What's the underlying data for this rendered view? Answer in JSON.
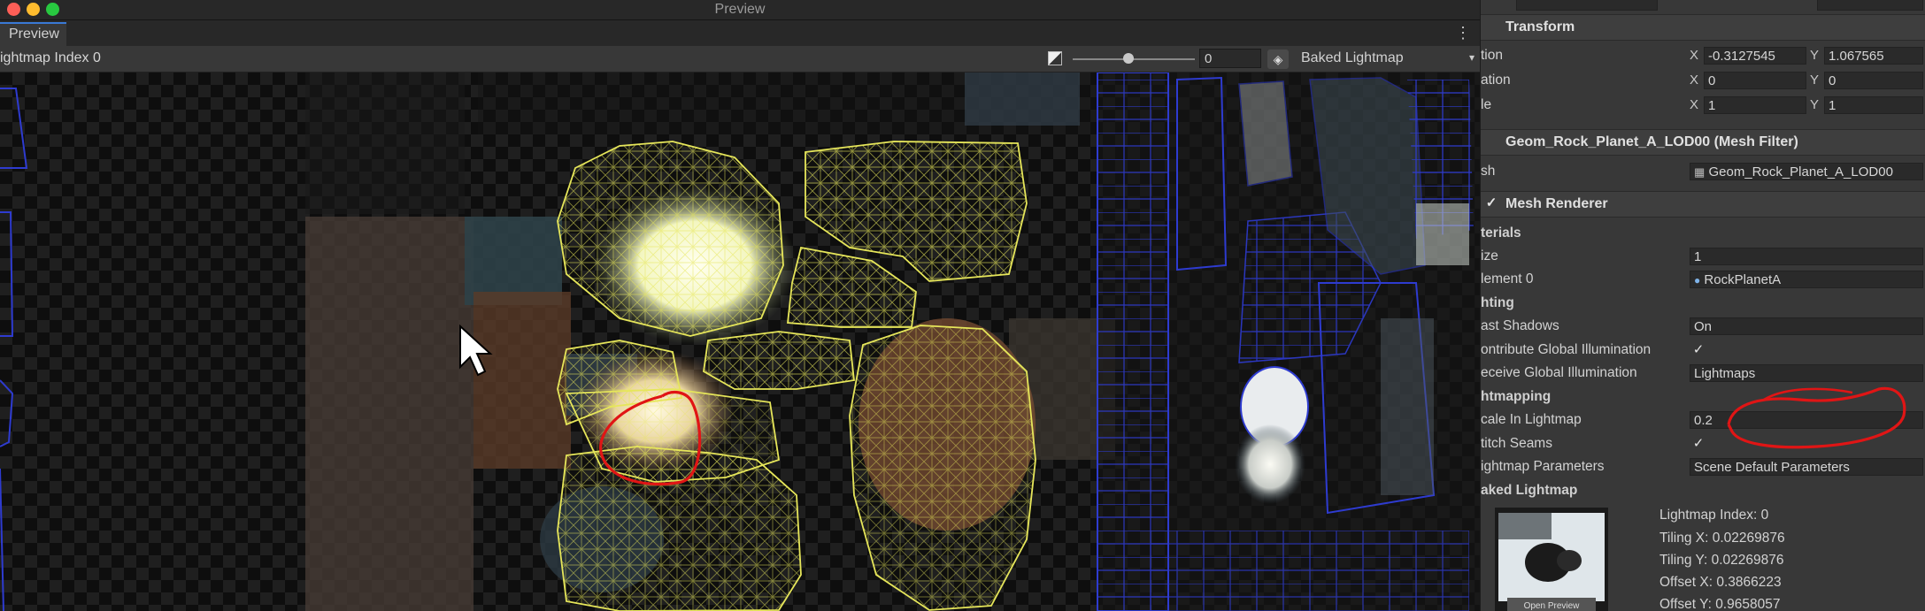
{
  "window": {
    "title": "Preview"
  },
  "tab": {
    "label": "Preview",
    "menu_glyph": "⋮"
  },
  "toolbar": {
    "lightmap_index_label": "ightmap Index 0",
    "exposure_value": "0",
    "exposure_level": 0.46,
    "mode_label": "Baked Lightmap",
    "mode_arrow": "▾"
  },
  "inspector": {
    "transform": {
      "title": "Transform",
      "rows": [
        {
          "label": "tion",
          "x_axis": "X",
          "x": "-0.3127545",
          "y_axis": "Y",
          "y": "1.067565"
        },
        {
          "label": "ation",
          "x_axis": "X",
          "x": "0",
          "y_axis": "Y",
          "y": "0"
        },
        {
          "label": "le",
          "x_axis": "X",
          "x": "1",
          "y_axis": "Y",
          "y": "1"
        }
      ]
    },
    "mesh_filter": {
      "title": "Geom_Rock_Planet_A_LOD00 (Mesh Filter)",
      "mesh_label": "sh",
      "mesh_value": "Geom_Rock_Planet_A_LOD00"
    },
    "mesh_renderer": {
      "title": "Mesh Renderer",
      "materials_label": "terials",
      "size_label": "ize",
      "size_value": "1",
      "element_label": "lement 0",
      "element_value": "RockPlanetA",
      "lighting_label": "hting",
      "cast_shadows_label": "ast Shadows",
      "cast_shadows_value": "On",
      "contribute_gi_label": "ontribute Global Illumination",
      "receive_gi_label": "eceive Global Illumination",
      "receive_gi_value": "Lightmaps",
      "lightmapping_label": "htmapping",
      "scale_label": "cale In Lightmap",
      "scale_value": "0.2",
      "stitch_label": "titch Seams",
      "params_label": "ightmap Parameters",
      "params_value": "Scene Default Parameters",
      "baked_label": "aked Lightmap",
      "lm_index": "Lightmap Index: 0",
      "tiling_x": "Tiling X: 0.02269876",
      "tiling_y": "Tiling Y: 0.02269876",
      "offset_x": "Offset X: 0.3866223",
      "offset_y": "Offset Y: 0.9658057",
      "thumb_caption": "Open Preview"
    }
  },
  "colors": {
    "accent": "#3a79d6",
    "uv_wire_yellow": "#e6e65a",
    "uv_wire_blue": "#2e3bd0",
    "annotation_red": "#e01515"
  }
}
